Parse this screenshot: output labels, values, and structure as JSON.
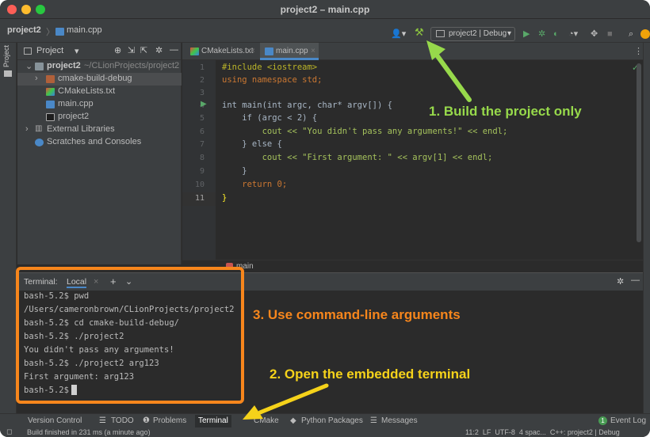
{
  "window": {
    "title": "project2 – main.cpp"
  },
  "navbar": {
    "breadcrumb_project": "project2",
    "breadcrumb_file": "main.cpp",
    "run_config": "project2 | Debug"
  },
  "project_pane": {
    "header": "Project",
    "side_label": "Project",
    "tree": [
      {
        "name": "project2",
        "path": "~/CLionProjects/project2"
      },
      {
        "name": "cmake-build-debug"
      },
      {
        "name": "CMakeLists.txt"
      },
      {
        "name": "main.cpp"
      },
      {
        "name": "project2"
      },
      {
        "name": "External Libraries"
      },
      {
        "name": "Scratches and Consoles"
      }
    ]
  },
  "editor": {
    "tabs": [
      "CMakeLists.txt",
      "main.cpp"
    ],
    "lines": [
      {
        "n": "1",
        "code": "#include <iostream>"
      },
      {
        "n": "2",
        "code": "using namespace std;"
      },
      {
        "n": "3",
        "code": ""
      },
      {
        "n": "4",
        "code": "int main(int argc, char* argv[]) {"
      },
      {
        "n": "5",
        "code": "    if (argc < 2) {"
      },
      {
        "n": "6",
        "code": "        cout << \"You didn't pass any arguments!\" << endl;"
      },
      {
        "n": "7",
        "code": "    } else {"
      },
      {
        "n": "8",
        "code": "        cout << \"First argument: \" << argv[1] << endl;"
      },
      {
        "n": "9",
        "code": "    }"
      },
      {
        "n": "10",
        "code": "    return 0;"
      },
      {
        "n": "11",
        "code": "}"
      }
    ],
    "breadcrumb": "main"
  },
  "terminal": {
    "label": "Terminal:",
    "tab": "Local",
    "lines": [
      "bash-5.2$ pwd",
      "/Users/cameronbrown/CLionProjects/project2",
      "bash-5.2$ cd cmake-build-debug/",
      "bash-5.2$ ./project2",
      "You didn't pass any arguments!",
      "bash-5.2$ ./project2 arg123",
      "First argument: arg123",
      "bash-5.2$ "
    ]
  },
  "toolwindows": [
    "Version Control",
    "TODO",
    "Problems",
    "Terminal",
    "CMake",
    "Python Packages",
    "Messages"
  ],
  "event_log": {
    "count": "1",
    "label": "Event Log"
  },
  "status": {
    "message": "Build finished in 231 ms (a minute ago)",
    "right": "11:2  LF  UTF-8  4 spac...  C++: project2 | Debug"
  },
  "annotations": {
    "build": "1. Build the project only",
    "terminal": "2. Open the embedded terminal",
    "args": "3. Use command-line arguments"
  },
  "colors": {
    "annotation_green": "#97d94b",
    "annotation_orange": "#f7861c",
    "annotation_yellow": "#f5d21a",
    "accent": "#4a88c7"
  }
}
